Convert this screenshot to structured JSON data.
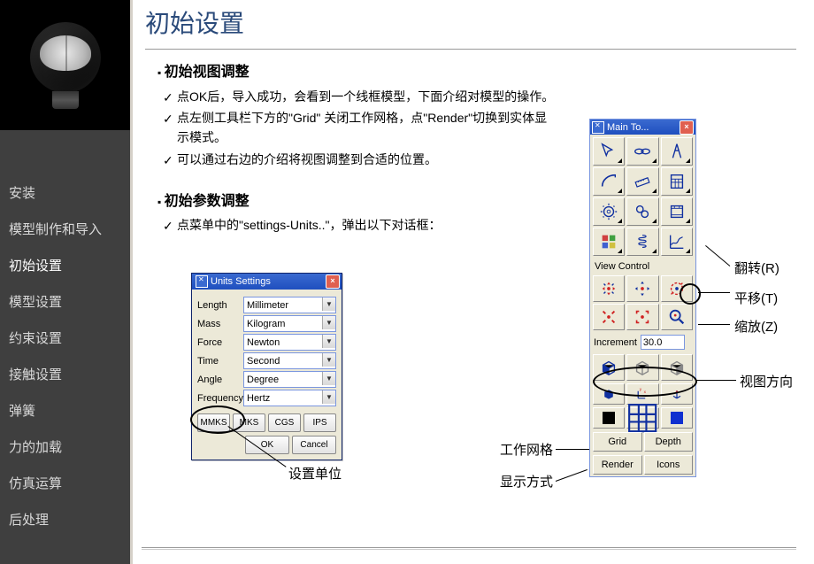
{
  "title": "初始设置",
  "nav": [
    "安装",
    "模型制作和导入",
    "初始设置",
    "模型设置",
    "约束设置",
    "接触设置",
    "弹簧",
    "力的加载",
    "仿真运算",
    "后处理"
  ],
  "nav_active": 2,
  "sec1": {
    "h": "初始视图调整",
    "b": [
      "点OK后，导入成功，会看到一个线框模型，下面介绍对模型的操作。",
      "点左侧工具栏下方的\"Grid\" 关闭工作网格，点\"Render\"切换到实体显示模式。",
      "可以通过右边的介绍将视图调整到合适的位置。"
    ]
  },
  "sec2": {
    "h": "初始参数调整",
    "b": [
      "点菜单中的\"settings-Units..\"，弹出以下对话框："
    ]
  },
  "units_dialog": {
    "title": "Units Settings",
    "rows": [
      {
        "label": "Length",
        "value": "Millimeter"
      },
      {
        "label": "Mass",
        "value": "Kilogram"
      },
      {
        "label": "Force",
        "value": "Newton"
      },
      {
        "label": "Time",
        "value": "Second"
      },
      {
        "label": "Angle",
        "value": "Degree"
      },
      {
        "label": "Frequency",
        "value": "Hertz"
      }
    ],
    "presets": [
      "MMKS",
      "MKS",
      "CGS",
      "IPS"
    ],
    "ok": "OK",
    "cancel": "Cancel"
  },
  "labels": {
    "set_units": "设置单位",
    "work_grid": "工作网格",
    "display_mode": "显示方式",
    "rotate": "翻转(R)",
    "pan": "平移(T)",
    "zoom": "缩放(Z)",
    "view_dir": "视图方向"
  },
  "toolbox": {
    "title": "Main To...",
    "view_control": "View Control",
    "increment_label": "Increment",
    "increment_value": "30.0",
    "grid": "Grid",
    "depth": "Depth",
    "render": "Render",
    "icons": "Icons"
  }
}
